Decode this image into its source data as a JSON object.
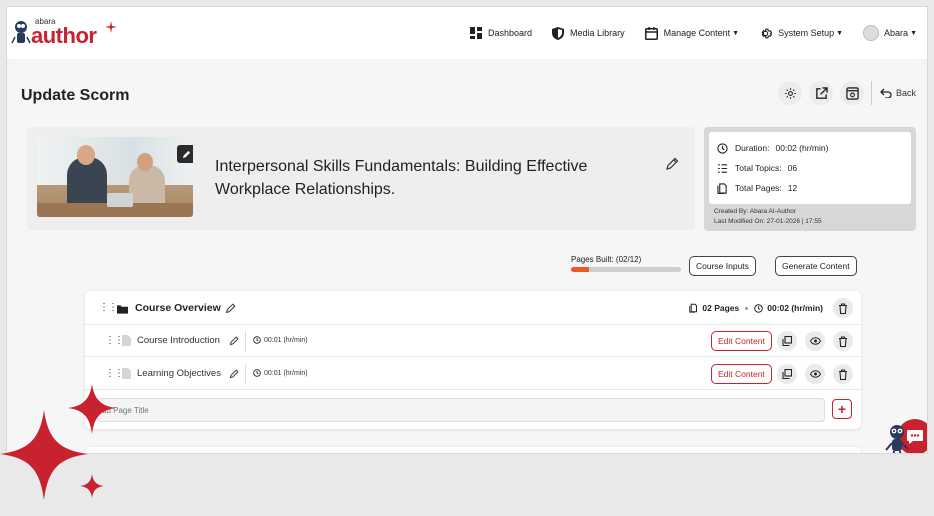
{
  "brand": {
    "small": "abara",
    "big": "author",
    "accent": "#c8222f"
  },
  "nav": {
    "dashboard": "Dashboard",
    "media_library": "Media Library",
    "manage_content": "Manage Content",
    "system_setup": "System Setup",
    "user": "Abara"
  },
  "page": {
    "title": "Update Scorm",
    "back": "Back",
    "tools": [
      "gear-icon",
      "external-link-icon",
      "preview-icon"
    ]
  },
  "course": {
    "title": "Interpersonal Skills Fundamentals: Building Effective Workplace Relationships."
  },
  "stats": {
    "duration_label": "Duration:",
    "duration_value": "00:02 (hr/min)",
    "topics_label": "Total Topics:",
    "topics_value": "06",
    "pages_label": "Total Pages:",
    "pages_value": "12",
    "created_by": "Created By: Abara AI-Author",
    "modified_on": "Last Modified On: 27-01-2026 | 17:55"
  },
  "progress": {
    "label": "Pages Built: (02/12)",
    "fraction": 0.1667,
    "color": "#ee5a24"
  },
  "actions": {
    "course_inputs": "Course Inputs",
    "generate_content": "Generate Content"
  },
  "section": {
    "name": "Course Overview",
    "pages": "02 Pages",
    "duration": "00:02 (hr/min)",
    "items": [
      {
        "name": "Course Introduction",
        "duration": "00:01 (hr/min)",
        "edit": "Edit Content"
      },
      {
        "name": "Learning Objectives",
        "duration": "00:01 (hr/min)",
        "edit": "Edit Content"
      }
    ],
    "add_placeholder": "dd Page Title"
  }
}
